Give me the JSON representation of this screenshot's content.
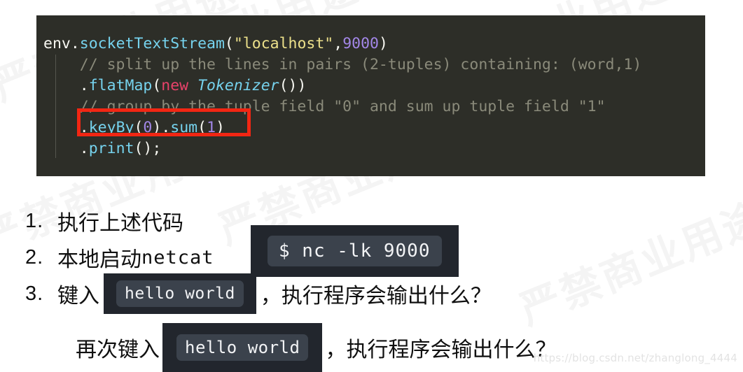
{
  "code_block": {
    "language": "java",
    "lines": [
      {
        "id": "line-1",
        "tokens": [
          {
            "text": "env",
            "type": "plain"
          },
          {
            "text": ".",
            "type": "punc"
          },
          {
            "text": "socketTextStream",
            "type": "fn"
          },
          {
            "text": "(",
            "type": "punc"
          },
          {
            "text": "\"localhost\"",
            "type": "str"
          },
          {
            "text": ",",
            "type": "punc"
          },
          {
            "text": "9000",
            "type": "num"
          },
          {
            "text": ")",
            "type": "punc"
          }
        ]
      },
      {
        "id": "line-2",
        "tokens": [
          {
            "text": "    // split up the lines in pairs (2-tuples) containing: (word,1)",
            "type": "comment"
          }
        ]
      },
      {
        "id": "line-3",
        "tokens": [
          {
            "text": "    ",
            "type": "plain"
          },
          {
            "text": ".",
            "type": "punc"
          },
          {
            "text": "flatMap",
            "type": "fn"
          },
          {
            "text": "(",
            "type": "punc"
          },
          {
            "text": "new",
            "type": "kw"
          },
          {
            "text": " ",
            "type": "plain"
          },
          {
            "text": "Tokenizer",
            "type": "type"
          },
          {
            "text": "())",
            "type": "punc"
          }
        ]
      },
      {
        "id": "line-4",
        "tokens": [
          {
            "text": "    // group by the tuple field \"0\" and sum up tuple field \"1\"",
            "type": "comment"
          }
        ]
      },
      {
        "id": "line-5",
        "tokens": [
          {
            "text": "    ",
            "type": "plain"
          },
          {
            "text": ".",
            "type": "punc"
          },
          {
            "text": "keyBy",
            "type": "fn"
          },
          {
            "text": "(",
            "type": "punc"
          },
          {
            "text": "0",
            "type": "num"
          },
          {
            "text": ")",
            "type": "punc"
          },
          {
            "text": ".",
            "type": "punc"
          },
          {
            "text": "sum",
            "type": "fn"
          },
          {
            "text": "(",
            "type": "punc"
          },
          {
            "text": "1",
            "type": "num"
          },
          {
            "text": ")",
            "type": "punc"
          }
        ]
      },
      {
        "id": "line-6",
        "tokens": [
          {
            "text": "    ",
            "type": "plain"
          },
          {
            "text": ".",
            "type": "punc"
          },
          {
            "text": "print",
            "type": "fn"
          },
          {
            "text": "();",
            "type": "punc"
          }
        ]
      }
    ],
    "highlight": {
      "target_line_text": ".keyBy(0).sum(1)",
      "color": "#f22613"
    },
    "background": "#2d2e28"
  },
  "steps": [
    {
      "number": "1.",
      "text": "执行上述代码",
      "mono_suffix": ""
    },
    {
      "number": "2.",
      "text": "本地启动",
      "mono_suffix": "netcat"
    },
    {
      "number": "3.",
      "text_before": "键入",
      "chip": "hello world",
      "text_after": "，执行程序会输出什么？"
    }
  ],
  "terminal_chip": {
    "command": "$ nc -lk 9000"
  },
  "last_line": {
    "text_before": "再次键入",
    "chip": "hello world",
    "text_after": "，执行程序会输出什么？"
  },
  "watermarks": {
    "background_text": "严禁商业用途",
    "footer_url": "https://blog.csdn.net/zhanglong_4444"
  },
  "colors": {
    "accent_red": "#f22613",
    "code_bg": "#2d2e28",
    "chip_outer": "#22262d",
    "chip_inner": "#3b424c"
  }
}
